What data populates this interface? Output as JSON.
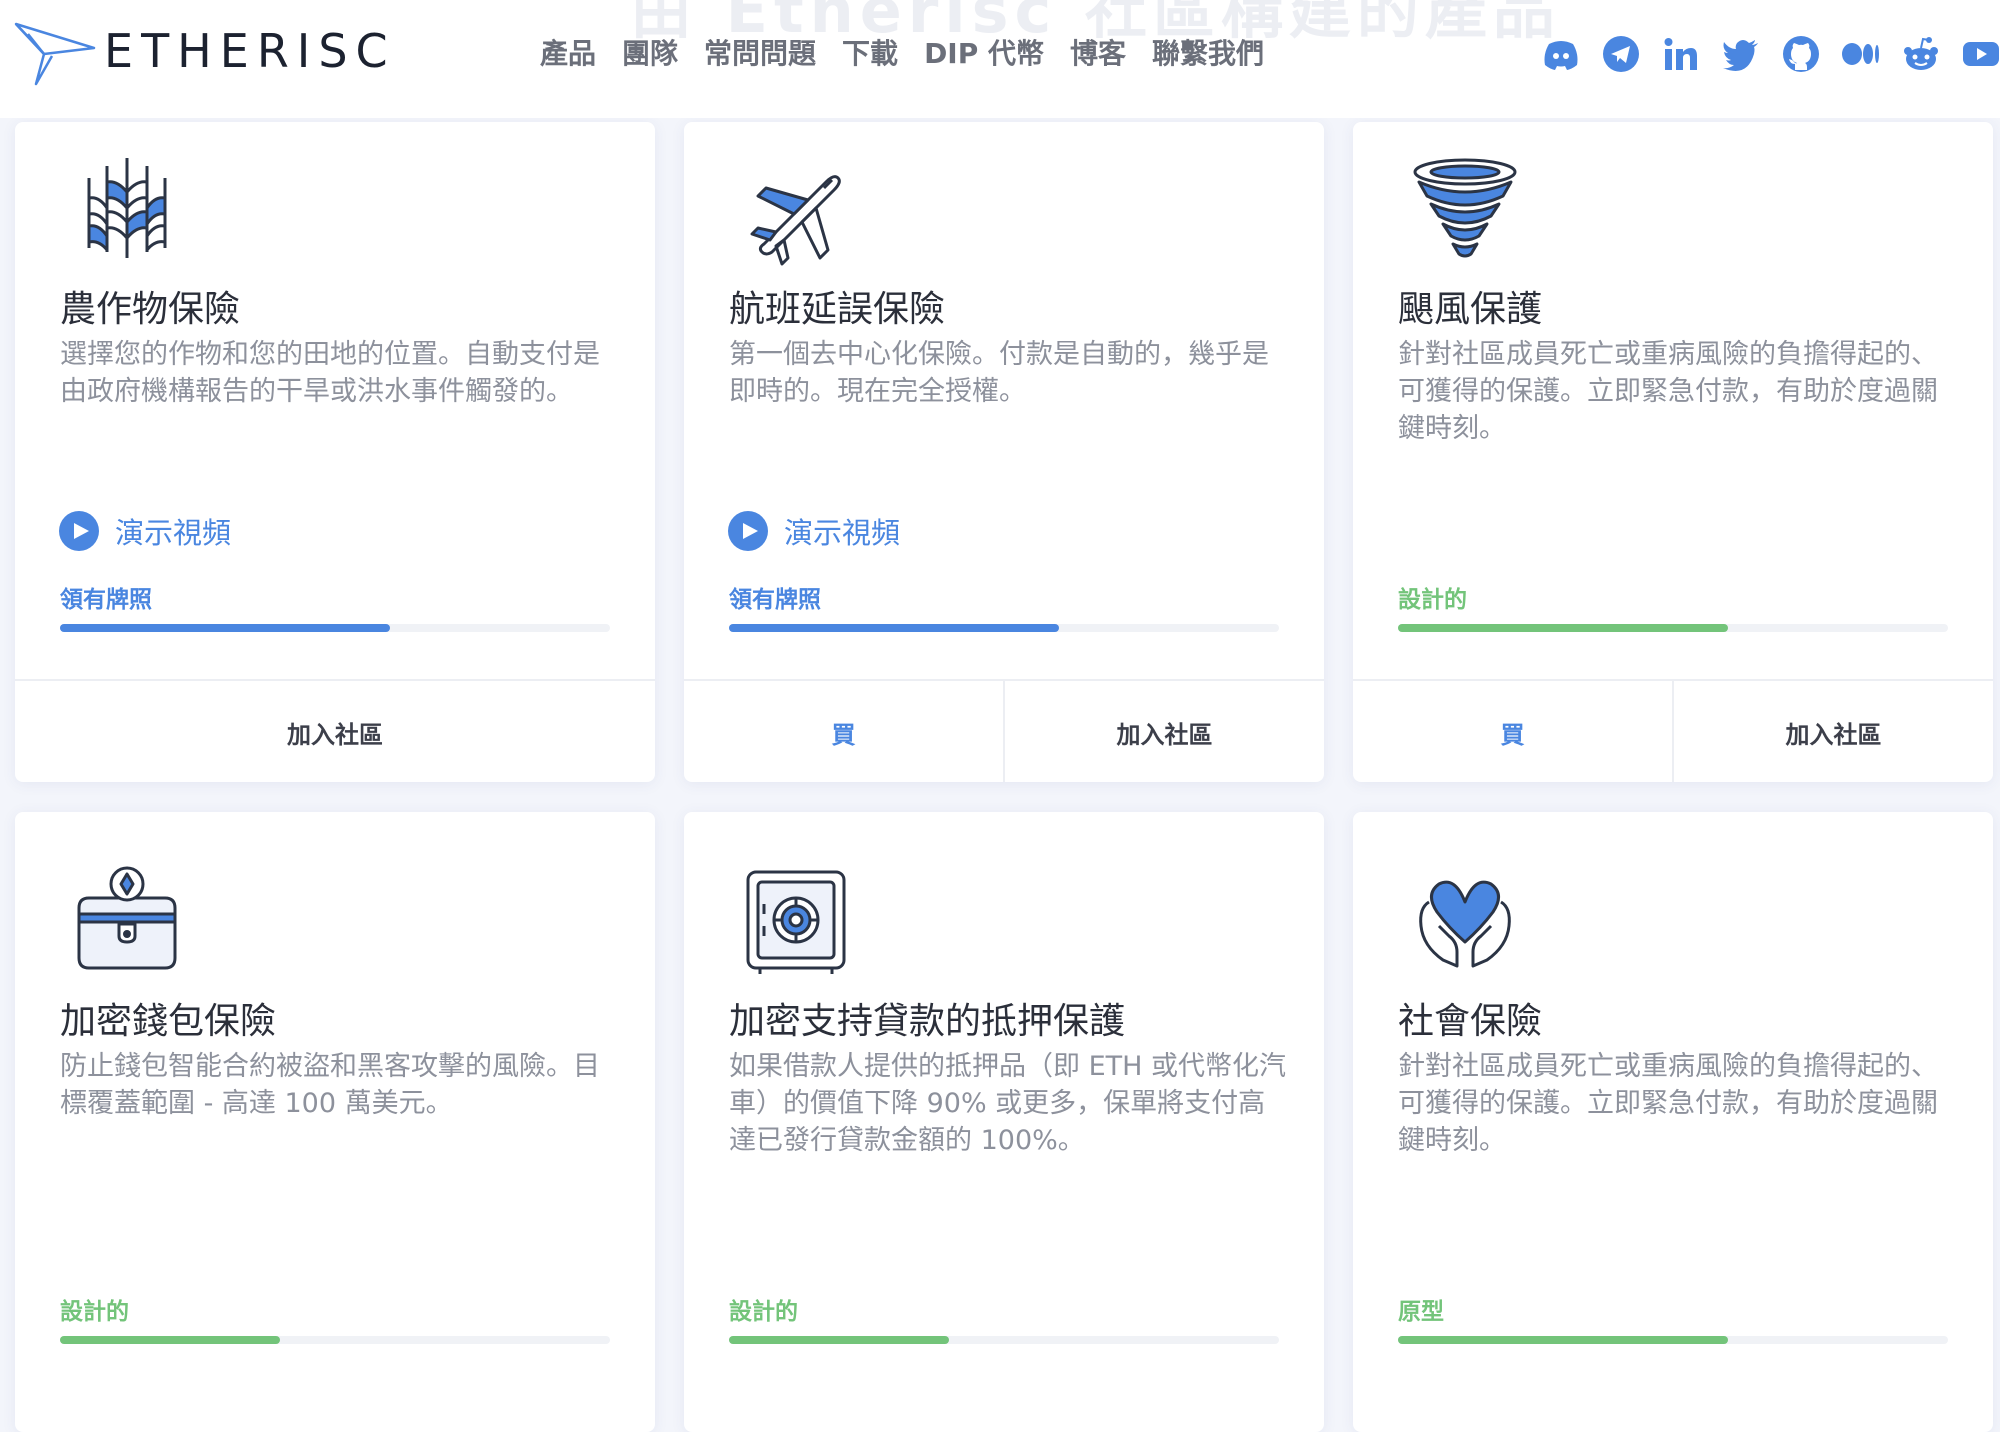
{
  "header": {
    "ghost_title": "由 Etherisc 社區構建的產品",
    "brand": "ETHERISC",
    "nav": [
      "產品",
      "團隊",
      "常問問題",
      "下載",
      "DIP 代幣",
      "博客",
      "聯繫我們"
    ],
    "social_icons": [
      "discord-icon",
      "telegram-icon",
      "linkedin-icon",
      "twitter-icon",
      "github-icon",
      "medium-icon",
      "reddit-icon",
      "youtube-icon"
    ]
  },
  "colors": {
    "accent_blue": "#4a86e0",
    "status_green": "#73c47a"
  },
  "cards": [
    {
      "icon": "crop-icon",
      "title": "農作物保險",
      "desc": "選擇您的作物和您的田地的位置。自動支付是由政府機構報告的干旱或洪水事件觸發的。",
      "demo": "演示視頻",
      "status": "領有牌照",
      "progress": 0.6,
      "actions": [
        "加入社區"
      ]
    },
    {
      "icon": "plane-icon",
      "title": "航班延誤保險",
      "desc": "第一個去中心化保險。付款是自動的，幾乎是即時的。現在完全授權。",
      "demo": "演示視頻",
      "status": "領有牌照",
      "progress": 0.6,
      "actions": [
        "買",
        "加入社區"
      ]
    },
    {
      "icon": "hurricane-icon",
      "title": "颶風保護",
      "desc": "針對社區成員死亡或重病風險的負擔得起的、可獲得的保護。立即緊急付款，有助於度過關鍵時刻。",
      "status": "設計的",
      "progress": 0.6,
      "actions": [
        "買",
        "加入社區"
      ]
    },
    {
      "icon": "crypto-wallet-icon",
      "title": "加密錢包保險",
      "desc": "防止錢包智能合約被盜和黑客攻擊的風險。目標覆蓋範圍 - 高達 100 萬美元。",
      "status": "設計的",
      "progress": 0.4
    },
    {
      "icon": "safe-icon",
      "title": "加密支持貸款的抵押保護",
      "desc": "如果借款人提供的抵押品（即 ETH 或代幣化汽車）的價值下降 90% 或更多，保單將支付高達已發行貸款金額的 100%。",
      "status": "設計的",
      "progress": 0.4
    },
    {
      "icon": "heart-hands-icon",
      "title": "社會保險",
      "desc": "針對社區成員死亡或重病風險的負擔得起的、可獲得的保護。立即緊急付款，有助於度過關鍵時刻。",
      "status": "原型",
      "progress": 0.6
    }
  ]
}
